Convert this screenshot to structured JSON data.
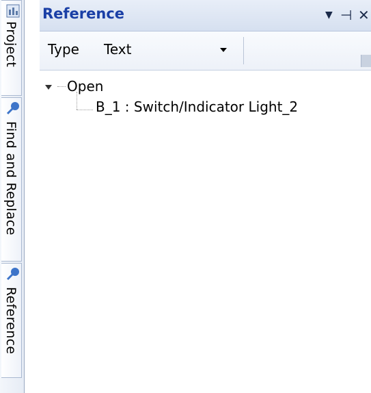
{
  "side_tabs": [
    {
      "label": "Project",
      "icon": "project-icon"
    },
    {
      "label": "Find and Replace",
      "icon": "magnifier-icon"
    },
    {
      "label": "Reference",
      "icon": "magnifier-icon"
    }
  ],
  "panel": {
    "title": "Reference",
    "buttons": {
      "dropdown": "▼",
      "pin": "⊣",
      "close": "✕"
    }
  },
  "filter": {
    "label": "Type",
    "selected": "Text"
  },
  "tree": {
    "root": {
      "label": "Open",
      "expanded": true
    },
    "children": [
      {
        "label": "B_1 : Switch/Indicator Light_2"
      }
    ]
  },
  "colors": {
    "title": "#1a3fa6",
    "accent": "#2f6ad1"
  }
}
